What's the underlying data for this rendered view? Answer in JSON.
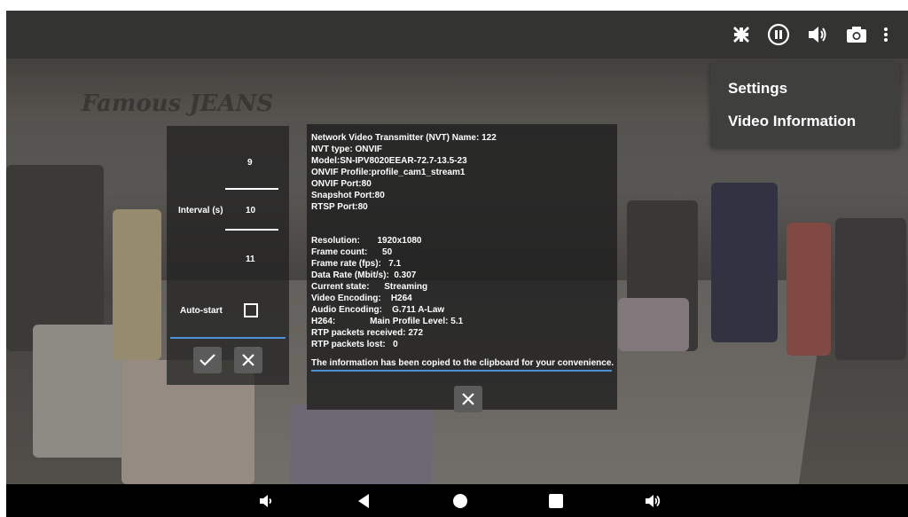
{
  "topbar": {
    "icons": [
      "exit-fullscreen-icon",
      "pause-icon",
      "volume-icon",
      "snapshot-camera-icon",
      "more-vert-icon"
    ]
  },
  "menu": {
    "items": [
      "Settings",
      "Video Information"
    ]
  },
  "interval_panel": {
    "values": [
      "9",
      "10",
      "11"
    ],
    "interval_label": "Interval (s)",
    "autostart_label": "Auto-start",
    "autostart_checked": false
  },
  "info": {
    "lines_top": [
      "Network Video Transmitter (NVT) Name: 122",
      "NVT type: ONVIF",
      "Model:SN-IPV8020EEAR-72.7-13.5-23",
      "ONVIF Profile:profile_cam1_stream1",
      "ONVIF Port:80",
      "Snapshot Port:80",
      "RTSP Port:80"
    ],
    "lines_bottom": [
      "Resolution:       1920x1080",
      "Frame count:      50",
      "Frame rate (fps):   7.1",
      "Data Rate (Mbit/s):  0.307",
      "Current state:      Streaming",
      "Video Encoding:    H264",
      "Audio Encoding:    G.711 A-Law",
      "H264:              Main Profile Level: 5.1",
      "RTP packets received: 272",
      "RTP packets lost:   0"
    ],
    "copied_message": "The information has been copied to the clipboard for your convenience."
  },
  "navbar": {
    "icons": [
      "volume-down-icon",
      "back-icon",
      "home-icon",
      "recents-icon",
      "volume-up-icon"
    ]
  },
  "colors": {
    "accent_line": "#4a90d9",
    "panel_bg": "#1e1e1e",
    "menu_bg": "#3f3f3e"
  }
}
